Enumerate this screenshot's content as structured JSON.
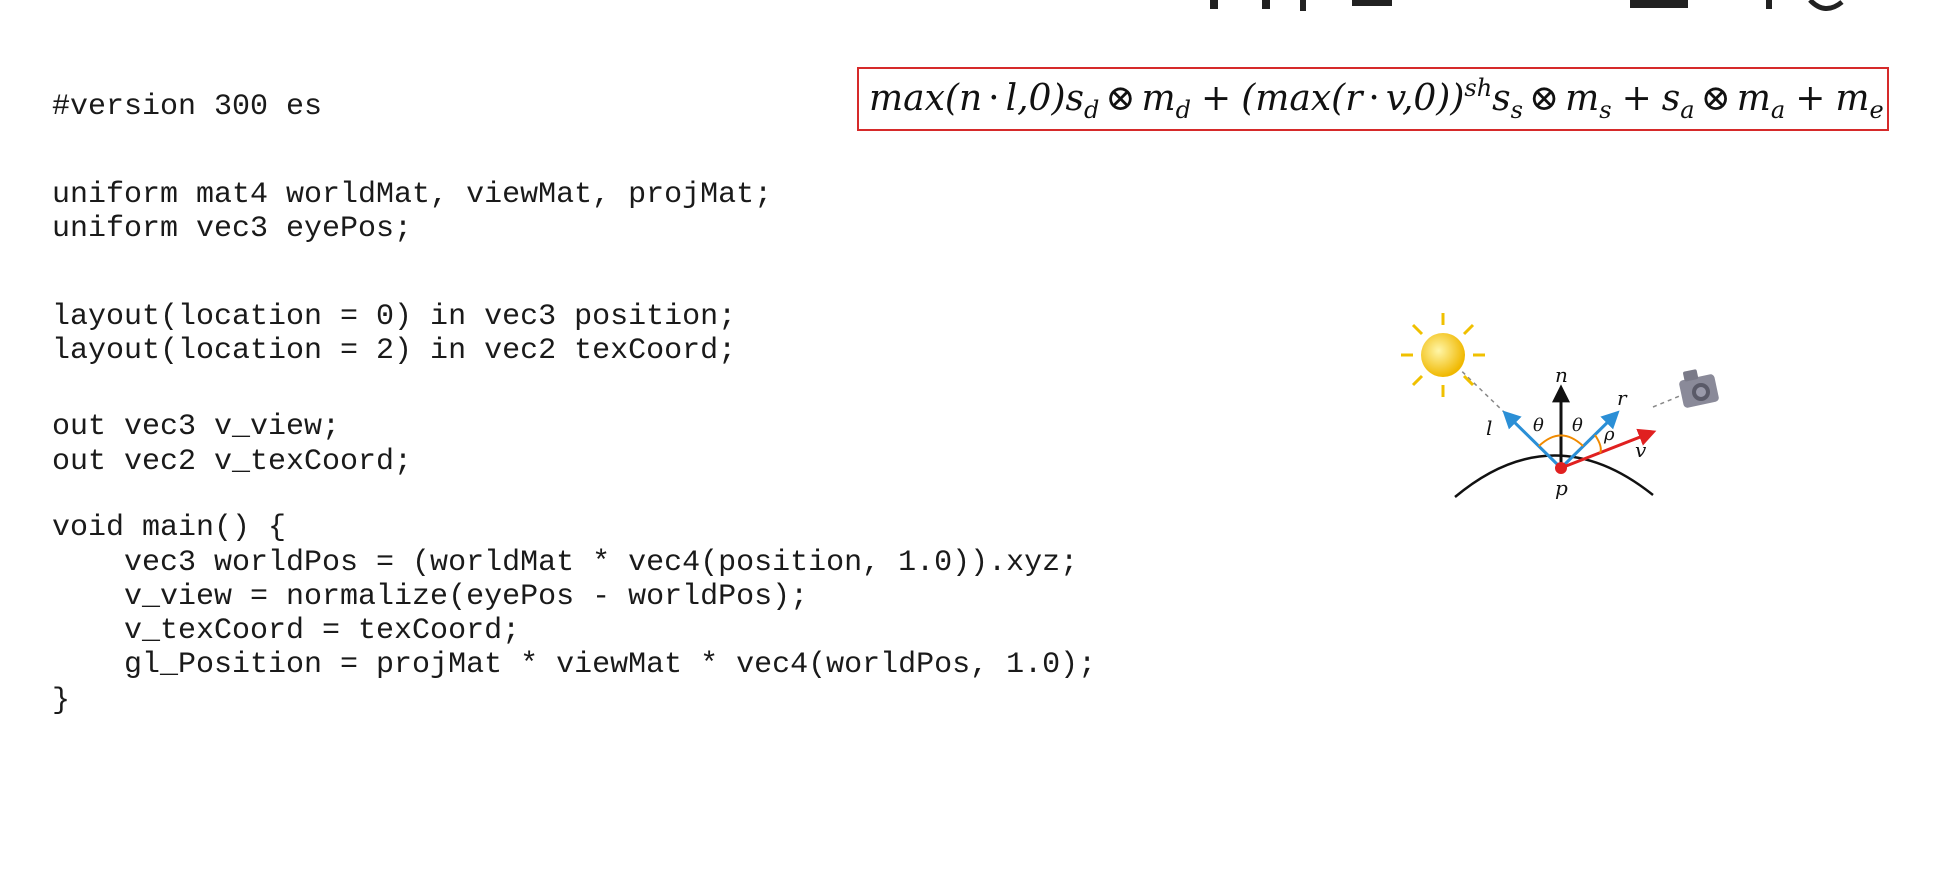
{
  "code": {
    "lines": [
      "#version 300 es",
      "",
      "uniform mat4 worldMat, viewMat, projMat;",
      "uniform vec3 eyePos;",
      "",
      "layout(location = 0) in vec3 position;",
      "layout(location = 2) in vec2 texCoord;",
      "",
      "out vec3 v_view;",
      "out vec2 v_texCoord;",
      "",
      "void main() {",
      "    vec3 worldPos = (worldMat * vec4(position, 1.0)).xyz;",
      "    v_view = normalize(eyePos - worldPos);",
      "    v_texCoord = texCoord;",
      "    gl_Position = projMat * viewMat * vec4(worldPos, 1.0);",
      "}"
    ]
  },
  "formula": {
    "t1": "max(n",
    "dot1": "·",
    "t2": "l,0)s",
    "sub_d1": "d",
    "otimes1": "⊗",
    "t3": "m",
    "sub_d2": "d",
    "plus1": "+",
    "t4": "(max(r",
    "dot2": "·",
    "t5": "v,0))",
    "sup_sh": "sh",
    "t6": "s",
    "sub_s1": "s",
    "otimes2": "⊗",
    "t7": "m",
    "sub_s2": "s",
    "plus2": "+",
    "t8": "s",
    "sub_a1": "a",
    "otimes3": "⊗",
    "t9": "m",
    "sub_a2": "a",
    "plus3": "+",
    "t10": "m",
    "sub_e": "e",
    "border_color": "#d62a2a"
  },
  "diagram": {
    "label_n": "n",
    "label_l": "l",
    "label_r": "r",
    "label_v": "v",
    "label_p": "p",
    "label_theta_left": "θ",
    "label_theta_right": "θ",
    "label_rho": "ρ",
    "colors": {
      "light_vector": "#2b8fd6",
      "reflect_vector": "#2b8fd6",
      "view_vector": "#e02020",
      "normal_vector": "#111111",
      "angle_arc": "#f08a00",
      "point": "#e02020",
      "sun": "#f5c400",
      "camera": "#8a8a99"
    },
    "icons": [
      "sun-icon",
      "camera-icon"
    ]
  }
}
